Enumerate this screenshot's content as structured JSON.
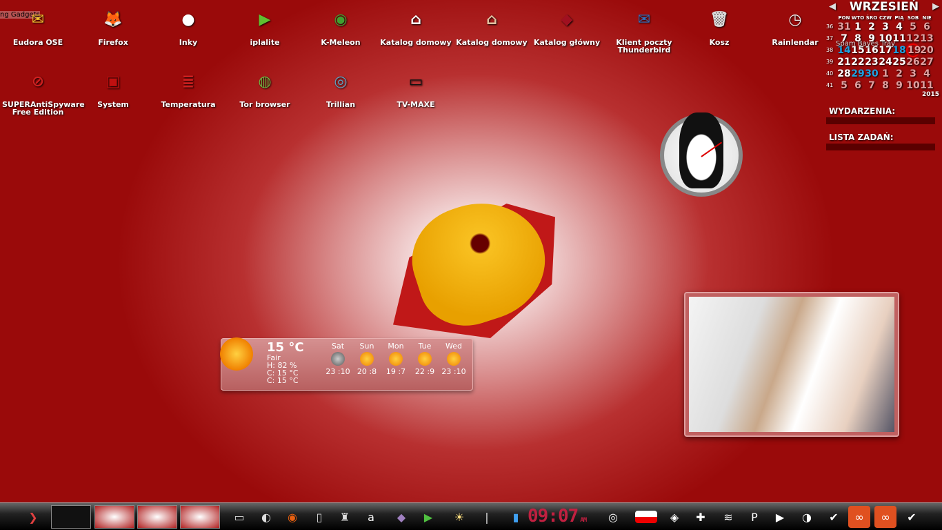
{
  "gadgets_label": "ng Gadgets",
  "desktop_icons": [
    {
      "label": "Eudora OSE",
      "glyph": "✉",
      "color": "#f0c030"
    },
    {
      "label": "Firefox",
      "glyph": "🦊",
      "color": "#e86010"
    },
    {
      "label": "Inky",
      "glyph": "●",
      "color": "#ffffff"
    },
    {
      "label": "iplalite",
      "glyph": "▶",
      "color": "#60c030"
    },
    {
      "label": "K-Meleon",
      "glyph": "◉",
      "color": "#40a030"
    },
    {
      "label": "Katalog domowy",
      "glyph": "⌂",
      "color": "#ffffff"
    },
    {
      "label": "Katalog domowy",
      "glyph": "⌂",
      "color": "#e0c0a0"
    },
    {
      "label": "Katalog główny",
      "glyph": "◆",
      "color": "#a01020"
    },
    {
      "label": "Klient poczty Thunderbird",
      "glyph": "✉",
      "color": "#3070c0"
    },
    {
      "label": "Kosz",
      "glyph": "🗑",
      "color": "#dddddd"
    },
    {
      "label": "Rainlendar",
      "glyph": "◷",
      "color": "#eeeeee"
    },
    {
      "label": "SUPERAntiSpyware Free Edition",
      "glyph": "⊘",
      "color": "#d02020"
    },
    {
      "label": "System",
      "glyph": "▣",
      "color": "#c01010"
    },
    {
      "label": "Temperatura",
      "glyph": "≣",
      "color": "#d02020"
    },
    {
      "label": "Tor browser",
      "glyph": "◍",
      "color": "#70b040"
    },
    {
      "label": "Trillian",
      "glyph": "◎",
      "color": "#60a0c0"
    },
    {
      "label": "TV-MAXE",
      "glyph": "▭",
      "color": "#111111"
    }
  ],
  "calendar": {
    "month": "WRZESIEŃ",
    "year": "2015",
    "days": [
      "PON",
      "WTO",
      "ŚRO",
      "CZW",
      "PIĄ",
      "SOB",
      "NIE"
    ],
    "overlay_text": "Spam Bayes Tray",
    "weeks": [
      {
        "num": "36",
        "days": [
          "31",
          "1",
          "2",
          "3",
          "4",
          "5",
          "6"
        ]
      },
      {
        "num": "37",
        "days": [
          "7",
          "8",
          "9",
          "10",
          "11",
          "12",
          "13"
        ]
      },
      {
        "num": "38",
        "days": [
          "14",
          "15",
          "16",
          "17",
          "18",
          "19",
          "20"
        ]
      },
      {
        "num": "39",
        "days": [
          "21",
          "22",
          "23",
          "24",
          "25",
          "26",
          "27"
        ]
      },
      {
        "num": "40",
        "days": [
          "28",
          "29",
          "30",
          "1",
          "2",
          "3",
          "4"
        ]
      },
      {
        "num": "41",
        "days": [
          "5",
          "6",
          "7",
          "8",
          "9",
          "10",
          "11"
        ]
      }
    ],
    "today": "19",
    "events_label": "WYDARZENIA:",
    "tasks_label": "LISTA ZADAŃ:"
  },
  "weather": {
    "temp": "15 °C",
    "condition": "Fair",
    "humidity": "H: 82 %",
    "line1": "C: 15 °C",
    "line2": "C: 15 °C",
    "forecast": [
      {
        "day": "Sat",
        "temps": "23 :10"
      },
      {
        "day": "Sun",
        "temps": "20 :8"
      },
      {
        "day": "Mon",
        "temps": "19 :7"
      },
      {
        "day": "Tue",
        "temps": "22 :9"
      },
      {
        "day": "Wed",
        "temps": "23 :10"
      }
    ]
  },
  "taskbar": {
    "clock": "09:07",
    "ampm": "AM",
    "launchers": [
      "terminal",
      "screenshot",
      "firefox",
      "file",
      "game",
      "a",
      "pidgin",
      "play",
      "bulb",
      "thermometer",
      "battery"
    ],
    "tray": [
      "volume",
      "flag-pl",
      "network",
      "puzzle",
      "wifi",
      "p",
      "play",
      "chat",
      "bird",
      "link",
      "link",
      "bird"
    ]
  }
}
